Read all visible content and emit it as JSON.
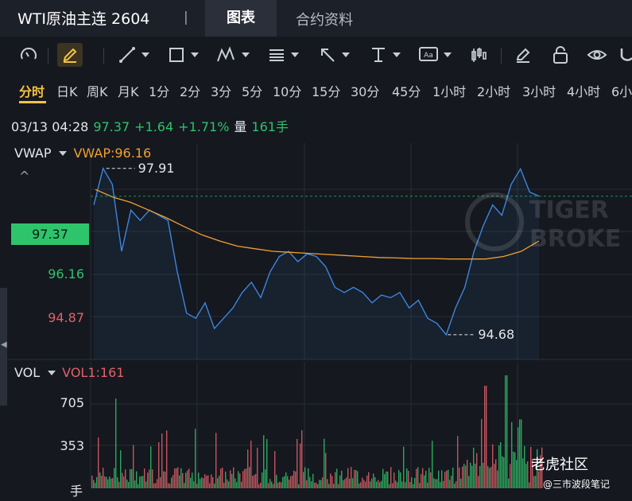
{
  "header": {
    "title": "WTI原油主连 2604",
    "separator": "|",
    "tabs": [
      {
        "label": "图表",
        "active": true
      },
      {
        "label": "合约资料",
        "active": false
      }
    ]
  },
  "toolbar": {
    "tools": [
      {
        "icon": "gauge-icon"
      },
      {
        "icon": "pencil-icon",
        "active": true
      },
      {
        "icon": "trend-line-icon",
        "dropdown": true
      },
      {
        "icon": "rectangle-icon",
        "dropdown": true
      },
      {
        "icon": "wave-pattern-icon",
        "dropdown": true
      },
      {
        "icon": "fibonacci-icon",
        "dropdown": true
      },
      {
        "icon": "arrow-icon",
        "dropdown": true
      },
      {
        "icon": "text-cursor-icon",
        "dropdown": true
      },
      {
        "icon": "text-box-icon",
        "dropdown": true
      },
      {
        "icon": "candlestick-icon"
      },
      {
        "icon": "eraser-icon"
      },
      {
        "icon": "lock-icon"
      },
      {
        "icon": "eye-icon"
      },
      {
        "icon": "magnet-icon"
      }
    ]
  },
  "periods": [
    "分时",
    "日K",
    "周K",
    "月K",
    "1分",
    "2分",
    "3分",
    "5分",
    "10分",
    "15分",
    "30分",
    "45分",
    "1小时",
    "2小时",
    "3小时",
    "4小时",
    "6小"
  ],
  "active_period": "分时",
  "info": {
    "datetime": "03/13 04:28",
    "price": "97.37",
    "change": "+1.64",
    "change_pct": "+1.71%",
    "volume_label": "量",
    "volume": "161手"
  },
  "main_panel": {
    "indicator_name": "VWAP",
    "indicator_value": "VWAP:96.16",
    "collapse_glyph": "^",
    "price_badge": "97.37",
    "y_labels": {
      "vwap": "96.16",
      "low": "94.87"
    },
    "high_annotation": "97.91",
    "low_annotation": "94.68"
  },
  "volume_panel": {
    "indicator_name": "VOL",
    "indicator_value": "VOL1:161",
    "y_labels": [
      "705",
      "353"
    ],
    "unit": "手"
  },
  "watermark": {
    "brand_top": "TIGER",
    "brand_bottom": "BROKERS",
    "community": "老虎社区",
    "handle": "@三市波段笔记"
  },
  "colors": {
    "background": "#15181f",
    "up": "#2fc26a",
    "down": "#e0626a",
    "price_line": "#3b86e0",
    "vwap_line": "#f0a030",
    "active_period": "#f5c342"
  },
  "chart_data": {
    "type": "line",
    "series": [
      {
        "name": "VWAP",
        "values": [
          97.5,
          97.35,
          97.25,
          97.1,
          96.95,
          96.78,
          96.62,
          96.5,
          96.4,
          96.35,
          96.3,
          96.28,
          96.26,
          96.24,
          96.22,
          96.2,
          96.18,
          96.17,
          96.16,
          96.16,
          96.15,
          96.15,
          96.15,
          96.2,
          96.3,
          96.5
        ]
      },
      {
        "name": "",
        "values": [
          97.2,
          97.91,
          97.6,
          96.3,
          97.1,
          96.9,
          97.1,
          97.0,
          96.9,
          95.9,
          95.1,
          95.0,
          95.3,
          94.8,
          95.0,
          95.2,
          95.5,
          95.7,
          95.4,
          95.9,
          96.2,
          96.3,
          96.1,
          96.25,
          96.2,
          96.0,
          95.6,
          95.5,
          95.6,
          95.5,
          95.3,
          95.45,
          95.4,
          95.5,
          95.2,
          95.35,
          95.0,
          94.9,
          94.68,
          95.2,
          95.6,
          96.3,
          96.8,
          97.2,
          97.0,
          97.6,
          97.9,
          97.45,
          97.37
        ]
      }
    ],
    "volume": {
      "max_label": 705,
      "mid_label": 353,
      "last": 161
    },
    "ylim": [
      94.2,
      98.4
    ],
    "grid": true
  }
}
